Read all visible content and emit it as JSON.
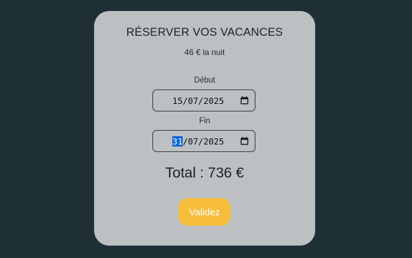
{
  "booking": {
    "title": "RÉSERVER VOS VACANCES",
    "price_per_night": "46 € la nuit",
    "start_label": "Début",
    "end_label": "Fin",
    "start_date": {
      "day": "15",
      "month": "07",
      "year": "2025",
      "separator": "/"
    },
    "end_date": {
      "day": "31",
      "month": "07",
      "year": "2025",
      "separator": "/"
    },
    "total": "Total : 736 €",
    "submit_label": "Validez"
  },
  "icons": {
    "date_picker": "calendar-icon"
  },
  "colors": {
    "background": "#1f2f36",
    "card": "#bcc0c3",
    "button": "#f6bd3c",
    "selection": "#0a64d6"
  }
}
